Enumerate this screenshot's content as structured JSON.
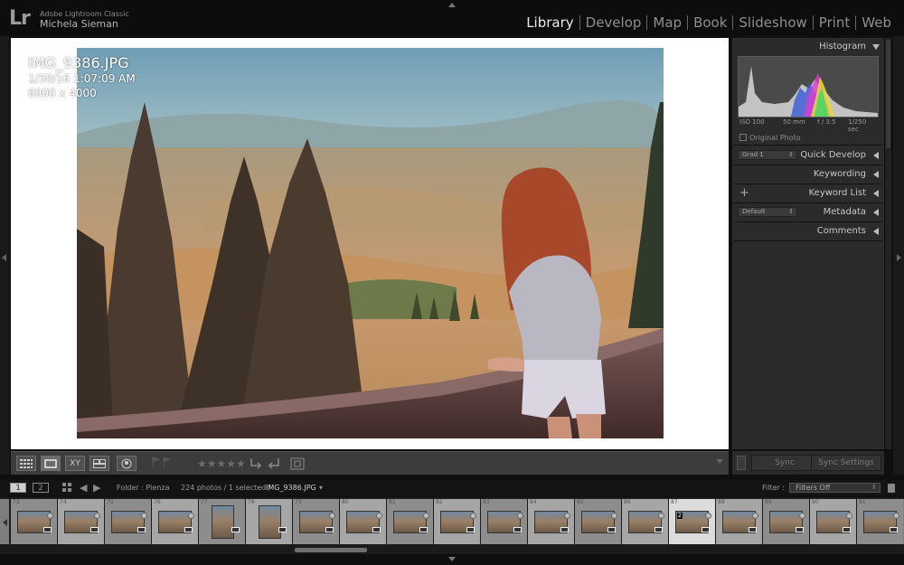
{
  "app": {
    "logo": "Lr",
    "name": "Adobe Lightroom Classic",
    "user": "Michela Sieman"
  },
  "modules": [
    "Library",
    "Develop",
    "Map",
    "Book",
    "Slideshow",
    "Print",
    "Web"
  ],
  "active_module": "Library",
  "photo_info": {
    "filename": "IMG_9386.JPG",
    "datetime": "1/30/16 1:07:09 AM",
    "dimensions": "6000 x 4000"
  },
  "right_panel": {
    "histogram_label": "Histogram",
    "iso": "ISO 100",
    "focal": "50 mm",
    "aperture": "f / 3.5",
    "shutter": "1/250 sec",
    "original_photo": "Original Photo",
    "quick_develop": {
      "label": "Quick Develop",
      "preset": "Grad 1"
    },
    "keywording": "Keywording",
    "keyword_list": {
      "label": "Keyword List",
      "plus": "+"
    },
    "metadata": {
      "label": "Metadata",
      "preset": "Default"
    },
    "comments": "Comments",
    "sync": "Sync",
    "sync_settings": "Sync Settings"
  },
  "filmstrip_header": {
    "monitor_1": "1",
    "monitor_2": "2",
    "folder": "Folder : Pienza",
    "count": "224 photos / 1 selected /",
    "current": "IMG_9386.JPG",
    "dropdown_caret": "▾",
    "filter_label": "Filter :",
    "filter_value": "Filters Off"
  },
  "filmstrip": {
    "numbers": [
      "73",
      "74",
      "75",
      "76",
      "77",
      "78",
      "79",
      "80",
      "81",
      "82",
      "83",
      "84",
      "85",
      "86",
      "87",
      "88",
      "89",
      "90",
      "91"
    ],
    "selected_index": 14,
    "selected_label": "2"
  },
  "toolbar": {
    "stars": "★★★★★",
    "compare_label": "XY"
  }
}
